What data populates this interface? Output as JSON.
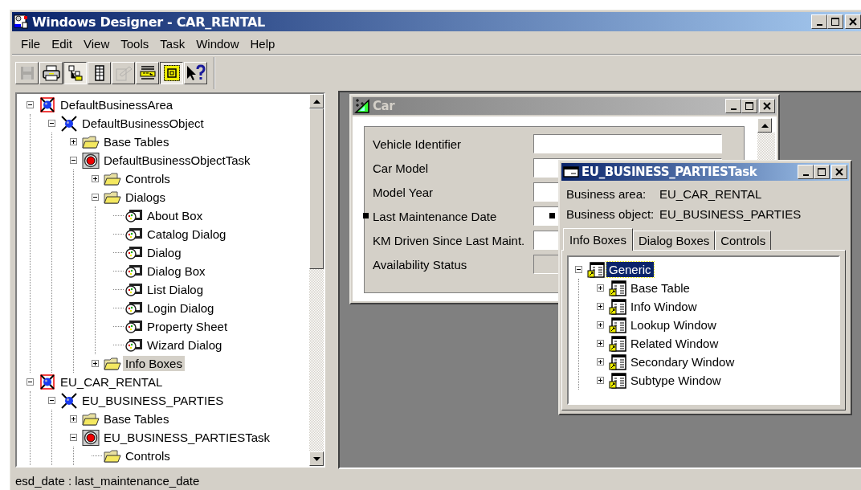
{
  "window": {
    "title": "Windows Designer - CAR_RENTAL"
  },
  "menu": [
    {
      "label": "File"
    },
    {
      "label": "Edit"
    },
    {
      "label": "View"
    },
    {
      "label": "Tools"
    },
    {
      "label": "Task"
    },
    {
      "label": "Window"
    },
    {
      "label": "Help"
    }
  ],
  "toolbar": [
    {
      "kind": "save",
      "pressed": false,
      "disabled": true
    },
    {
      "kind": "print",
      "pressed": false,
      "disabled": false
    },
    {
      "kind": "tree",
      "pressed": true,
      "disabled": false
    },
    {
      "kind": "list",
      "pressed": false,
      "disabled": false
    },
    {
      "kind": "wizard",
      "pressed": false,
      "disabled": true
    },
    {
      "kind": "sql",
      "pressed": false,
      "disabled": false
    },
    {
      "kind": "frame",
      "pressed": true,
      "disabled": false
    },
    {
      "kind": "help",
      "pressed": false,
      "disabled": false
    }
  ],
  "tree": {
    "items": [
      {
        "label": "DefaultBusinessArea",
        "kind": "area",
        "expanded": true,
        "selected": false,
        "children": [
          {
            "label": "DefaultBusinessObject",
            "kind": "object",
            "expanded": true,
            "selected": false,
            "children": [
              {
                "label": "Base Tables",
                "kind": "folder",
                "expanded": false,
                "selected": false
              },
              {
                "label": "DefaultBusinessObjectTask",
                "kind": "task",
                "expanded": true,
                "selected": false,
                "children": [
                  {
                    "label": "Controls",
                    "kind": "folder",
                    "expanded": false,
                    "selected": false
                  },
                  {
                    "label": "Dialogs",
                    "kind": "folder",
                    "expanded": true,
                    "selected": false,
                    "children": [
                      {
                        "label": "About Box",
                        "kind": "dialog",
                        "selected": false
                      },
                      {
                        "label": "Catalog Dialog",
                        "kind": "dialog",
                        "selected": false
                      },
                      {
                        "label": "Dialog",
                        "kind": "dialog",
                        "selected": false
                      },
                      {
                        "label": "Dialog Box",
                        "kind": "dialog",
                        "selected": false
                      },
                      {
                        "label": "List Dialog",
                        "kind": "dialog",
                        "selected": false
                      },
                      {
                        "label": "Login Dialog",
                        "kind": "dialog",
                        "selected": false
                      },
                      {
                        "label": "Property Sheet",
                        "kind": "dialog",
                        "selected": false
                      },
                      {
                        "label": "Wizard Dialog",
                        "kind": "dialog",
                        "selected": false
                      }
                    ]
                  },
                  {
                    "label": "Info Boxes",
                    "kind": "folder",
                    "expanded": false,
                    "selected": true
                  }
                ]
              }
            ]
          }
        ]
      },
      {
        "label": "EU_CAR_RENTAL",
        "kind": "area",
        "expanded": true,
        "selected": false,
        "children": [
          {
            "label": "EU_BUSINESS_PARTIES",
            "kind": "object",
            "expanded": true,
            "selected": false,
            "children": [
              {
                "label": "Base Tables",
                "kind": "folder",
                "expanded": false,
                "selected": false
              },
              {
                "label": "EU_BUSINESS_PARTIESTask",
                "kind": "task",
                "expanded": true,
                "selected": false,
                "children": [
                  {
                    "label": "Controls",
                    "kind": "folder",
                    "selected": false
                  }
                ]
              }
            ]
          }
        ]
      }
    ]
  },
  "car_window": {
    "title": "Car",
    "fields": [
      {
        "label": "Vehicle Identifier",
        "disabled": false,
        "selected": false
      },
      {
        "label": "Car Model",
        "disabled": false,
        "selected": false
      },
      {
        "label": "Model Year",
        "disabled": false,
        "selected": false
      },
      {
        "label": "Last Maintenance Date",
        "disabled": false,
        "selected": true
      },
      {
        "label": "KM Driven Since Last Maint.",
        "disabled": false,
        "selected": false
      },
      {
        "label": "Availability Status",
        "disabled": true,
        "selected": false
      }
    ]
  },
  "task_window": {
    "title": "EU_BUSINESS_PARTIESTask",
    "properties": [
      {
        "label": "Business area:",
        "value": "EU_CAR_RENTAL"
      },
      {
        "label": "Business object:",
        "value": "EU_BUSINESS_PARTIES"
      }
    ],
    "tabs": [
      {
        "label": "Info Boxes",
        "selected": true
      },
      {
        "label": "Dialog Boxes",
        "selected": false
      },
      {
        "label": "Controls",
        "selected": false
      }
    ],
    "tree": [
      {
        "label": "Generic",
        "expanded": true,
        "selected": true,
        "children": [
          {
            "label": "Base Table",
            "expanded": false,
            "selected": false
          },
          {
            "label": "Info Window",
            "expanded": false,
            "selected": false
          },
          {
            "label": "Lookup Window",
            "expanded": false,
            "selected": false
          },
          {
            "label": "Related Window",
            "expanded": false,
            "selected": false
          },
          {
            "label": "Secondary Window",
            "expanded": false,
            "selected": false
          },
          {
            "label": "Subtype Window",
            "expanded": false,
            "selected": false
          }
        ]
      }
    ]
  },
  "status_bar": "esd_date : last_maintenance_date"
}
